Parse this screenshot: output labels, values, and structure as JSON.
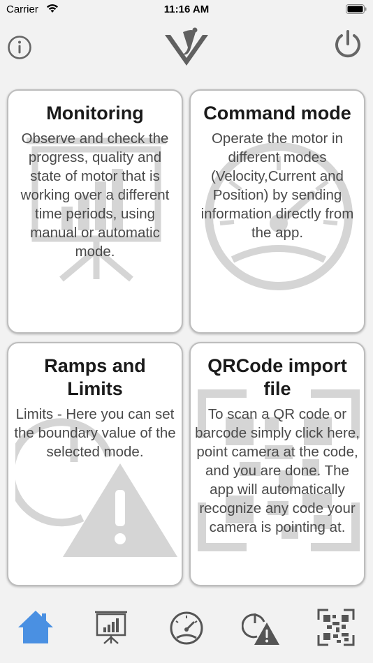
{
  "status_bar": {
    "carrier": "Carrier",
    "time": "11:16 AM"
  },
  "header": {
    "logo_icon": "v-check-logo-icon",
    "info_icon": "info-icon",
    "power_icon": "power-icon"
  },
  "cards": {
    "monitoring": {
      "title": "Monitoring",
      "description": "Observe and check the progress, quality and state of motor that is working over a different time periods, using manual or automatic mode.",
      "icon": "presentation-chart-icon"
    },
    "command": {
      "title": "Command mode",
      "description": "Operate the motor in different modes (Velocity,Current and Position) by sending information directly from the app.",
      "icon": "speedometer-icon"
    },
    "ramps": {
      "title": "Ramps and Limits",
      "description": "Limits - Here you can set the boundary value of the selected mode.",
      "icon": "clock-warning-icon"
    },
    "qrcode": {
      "title": "QRCode import file",
      "description": "To scan a QR code or barcode simply click here, point camera at the code, and you are done. The app will automatically recognize any code your camera is pointing at.",
      "icon": "qr-code-icon"
    }
  },
  "tab_bar": {
    "active": "home",
    "active_color": "#4a90e2",
    "inactive_color": "#555555",
    "tabs": [
      "home-icon",
      "presentation-chart-icon",
      "speedometer-icon",
      "clock-warning-icon",
      "qr-code-icon"
    ]
  }
}
